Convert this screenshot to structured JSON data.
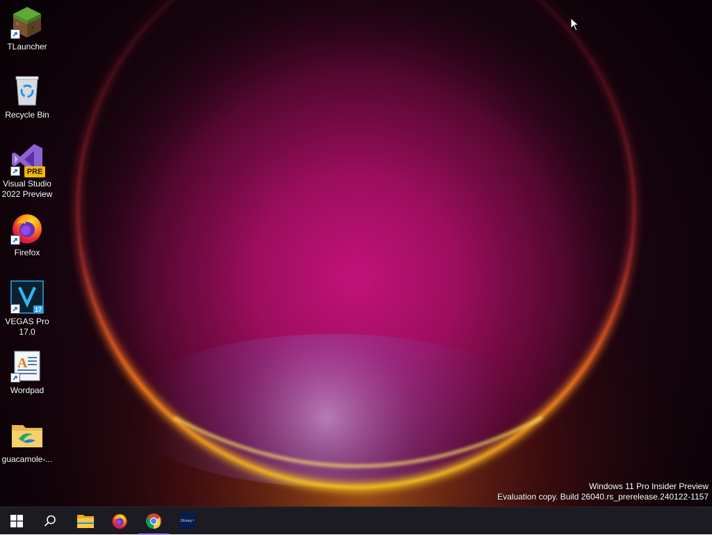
{
  "desktop": {
    "icons": [
      {
        "label": "TLauncher",
        "icon": "tlauncher-grass-block-icon",
        "shortcut": true
      },
      {
        "label": "Recycle Bin",
        "icon": "recycle-bin-icon",
        "shortcut": false
      },
      {
        "label": "Visual Studio\n2022 Preview",
        "icon": "visual-studio-preview-icon",
        "badge": "PRE",
        "shortcut": true
      },
      {
        "label": "Firefox",
        "icon": "firefox-icon",
        "shortcut": true
      },
      {
        "label": "VEGAS Pro\n17.0",
        "icon": "vegas-pro-icon",
        "badge": "17",
        "shortcut": true
      },
      {
        "label": "Wordpad",
        "icon": "wordpad-icon",
        "shortcut": true
      },
      {
        "label": "guacamole-...",
        "icon": "folder-icon",
        "shortcut": false
      }
    ]
  },
  "watermark": {
    "line1": "Windows 11 Pro Insider Preview",
    "line2": "Evaluation copy. Build 26040.rs_prerelease.240122-1157"
  },
  "taskbar": {
    "items": [
      {
        "name": "start-button",
        "icon": "windows-logo-icon",
        "active": false
      },
      {
        "name": "search-button",
        "icon": "search-icon",
        "active": false
      },
      {
        "name": "file-explorer-button",
        "icon": "file-explorer-icon",
        "active": false
      },
      {
        "name": "firefox-taskbar-button",
        "icon": "firefox-icon",
        "active": false
      },
      {
        "name": "chrome-taskbar-button",
        "icon": "chrome-icon",
        "active": true
      },
      {
        "name": "disney-plus-taskbar-button",
        "icon": "disney-plus-icon",
        "active": false
      }
    ],
    "disney_label": "Disney+"
  },
  "colors": {
    "taskbar_bg": "#1c1b22",
    "active_indicator": "#b79ae8",
    "wallpaper_glow": "#c3127a",
    "wallpaper_rim": "#ff7a1c"
  }
}
